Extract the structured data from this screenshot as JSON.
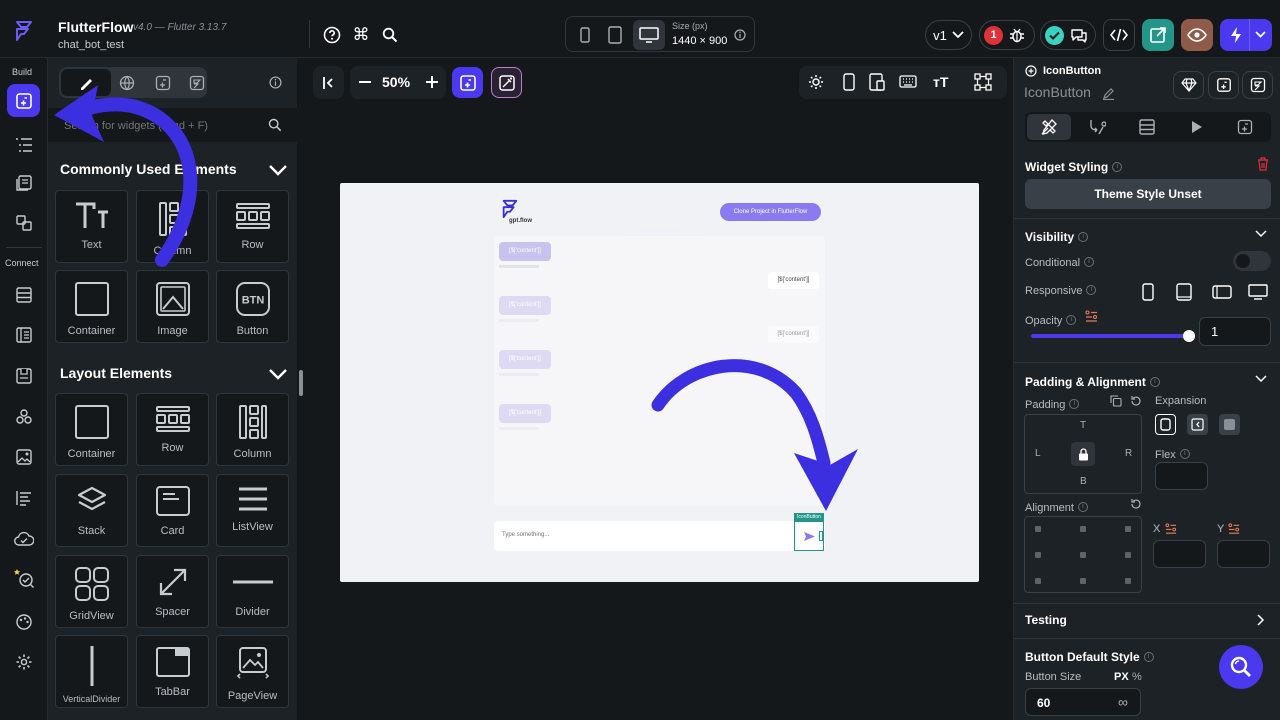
{
  "app": {
    "name": "FlutterFlow",
    "version": "v4.0 — Flutter 3.13.7",
    "project": "chat_bot_test"
  },
  "topbar": {
    "size_label": "Size (px)",
    "size_value": "1440 × 900",
    "branch": "v1",
    "error_count": "1"
  },
  "rail": {
    "build_label": "Build",
    "connect_label": "Connect"
  },
  "leftpanel": {
    "search_placeholder": "Search for widgets (Cmd + F)",
    "common": {
      "title": "Commonly Used Elements",
      "items": [
        "Text",
        "Column",
        "Row",
        "Container",
        "Image",
        "Button"
      ]
    },
    "layout": {
      "title": "Layout Elements",
      "items": [
        "Container",
        "Row",
        "Column",
        "Stack",
        "Card",
        "ListView",
        "GridView",
        "Spacer",
        "Divider",
        "VerticalDivider",
        "TabBar",
        "PageView"
      ]
    }
  },
  "canvas": {
    "zoom": "50%",
    "preview": {
      "logo_text": "gpt.flow",
      "clone_button": "Clone Project in FlutterFlow",
      "bubble_text": "[$['content']]",
      "input_placeholder": "Type something...",
      "selected_tag": "IconButton"
    }
  },
  "rightpanel": {
    "widget_type": "IconButton",
    "widget_name": "IconButton",
    "widget_styling": "Widget Styling",
    "theme_style": "Theme Style Unset",
    "visibility": "Visibility",
    "conditional": "Conditional",
    "responsive": "Responsive",
    "opacity": "Opacity",
    "opacity_value": "1",
    "opacity_fraction": 1,
    "padding_alignment": "Padding & Alignment",
    "padding": "Padding",
    "expansion": "Expansion",
    "pad_t": "T",
    "pad_l": "L",
    "pad_r": "R",
    "pad_b": "B",
    "flex": "Flex",
    "alignment": "Alignment",
    "x_label": "X",
    "y_label": "Y",
    "testing": "Testing",
    "button_default_style": "Button Default Style",
    "button_size": "Button Size",
    "unit_px": "PX",
    "unit_pct": "%",
    "button_size_value": "60",
    "infinity": "∞"
  },
  "colors": {
    "accent": "#4b39ef",
    "arrow": "#3b2fe0",
    "green": "#249689",
    "error": "#e0313a"
  }
}
